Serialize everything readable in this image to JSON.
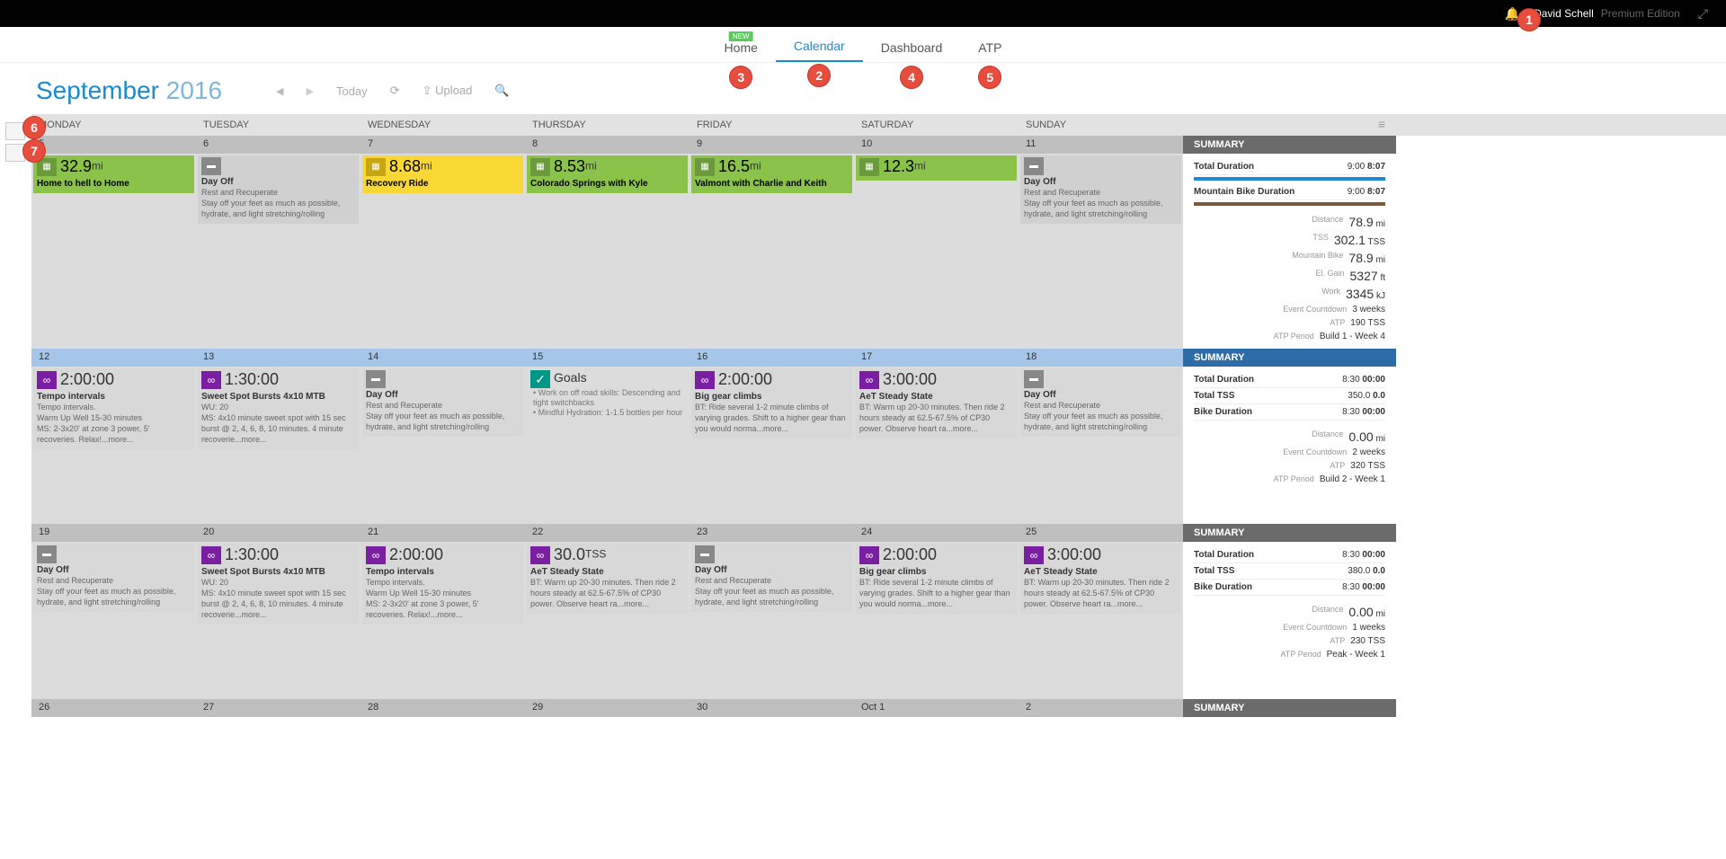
{
  "page": {
    "user": "David Schell",
    "edition": "Premium Edition"
  },
  "nav": {
    "home": "Home",
    "calendar": "Calendar",
    "dashboard": "Dashboard",
    "atp": "ATP",
    "new_badge": "NEW"
  },
  "circles": {
    "c1": "1",
    "c2": "2",
    "c3": "3",
    "c4": "4",
    "c5": "5",
    "c6": "6",
    "c7": "7"
  },
  "toolbar": {
    "month": "September",
    "year": "2016",
    "today": "Today",
    "upload": "Upload"
  },
  "dayHeaders": [
    "MONDAY",
    "TUESDAY",
    "WEDNESDAY",
    "THURSDAY",
    "FRIDAY",
    "SATURDAY",
    "SUNDAY"
  ],
  "summary_label": "SUMMARY",
  "week1": {
    "nums": [
      "5",
      "6",
      "7",
      "8",
      "9",
      "10",
      "11"
    ],
    "mon": {
      "value": "32.9",
      "unit": "mi",
      "title": "Home to hell to Home"
    },
    "tue": {
      "title": "Day Off",
      "sub": "Rest and Recuperate",
      "desc": "Stay off your feet as much as possible, hydrate, and light stretching/rolling"
    },
    "wed": {
      "value": "8.68",
      "unit": "mi",
      "title": "Recovery Ride"
    },
    "thu": {
      "value": "8.53",
      "unit": "mi",
      "title": "Colorado Springs with Kyle"
    },
    "fri": {
      "value": "16.5",
      "unit": "mi",
      "title": "Valmont with Charlie and Keith"
    },
    "sat": {
      "value": "12.3",
      "unit": "mi"
    },
    "sun": {
      "title": "Day Off",
      "sub": "Rest and Recuperate",
      "desc": "Stay off your feet as much as possible, hydrate, and light stretching/rolling"
    },
    "summary": {
      "total_duration_label": "Total Duration",
      "total_duration_plan": "9:00",
      "total_duration_act": "8:07",
      "mtb_label": "Mountain Bike Duration",
      "mtb_plan": "9:00",
      "mtb_act": "8:07",
      "stats": [
        {
          "k": "Distance",
          "v": "78.9",
          "u": "mi"
        },
        {
          "k": "TSS",
          "v": "302.1",
          "u": "TSS"
        },
        {
          "k": "Mountain Bike",
          "v": "78.9",
          "u": "mi"
        },
        {
          "k": "El. Gain",
          "v": "5327",
          "u": "ft"
        },
        {
          "k": "Work",
          "v": "3345",
          "u": "kJ"
        },
        {
          "k": "Event Countdown",
          "v": "3 weeks",
          "u": ""
        },
        {
          "k": "ATP",
          "v": "190 TSS",
          "u": ""
        },
        {
          "k": "ATP Period",
          "v": "Build 1 - Week 4",
          "u": ""
        }
      ]
    }
  },
  "week2": {
    "nums": [
      "12",
      "13",
      "14",
      "15",
      "16",
      "17",
      "18"
    ],
    "mon": {
      "value": "2:00:00",
      "title": "Tempo intervals",
      "desc": "Tempo intervals.\nWarm Up Well 15-30 minutes\nMS: 2-3x20' at zone 3 power, 5' recoveries. Relax!...more..."
    },
    "tue": {
      "value": "1:30:00",
      "title": "Sweet Spot Bursts 4x10 MTB",
      "desc": "WU: 20\nMS: 4x10 minute sweet spot with 15 sec burst @ 2, 4, 6, 8, 10 minutes. 4 minute recoverie...more..."
    },
    "wed": {
      "title": "Day Off",
      "sub": "Rest and Recuperate",
      "desc": "Stay off your feet as much as possible, hydrate, and light stretching/rolling"
    },
    "thu": {
      "title": "Goals",
      "g1": "Work on off road skills: Descending and tight switchbacks",
      "g2": "Mindful Hydration: 1-1.5 bottles per hour"
    },
    "fri": {
      "value": "2:00:00",
      "title": "Big gear climbs",
      "desc": "BT: Ride several 1-2 minute climbs of varying grades. Shift to a higher gear than you would norma...more..."
    },
    "sat": {
      "value": "3:00:00",
      "title": "AeT Steady State",
      "desc": "BT: Warm up 20-30 minutes. Then ride 2 hours steady at 62.5-67.5% of CP30 power. Observe heart ra...more..."
    },
    "sun": {
      "title": "Day Off",
      "sub": "Rest and Recuperate",
      "desc": "Stay off your feet as much as possible, hydrate, and light stretching/rolling"
    },
    "summary": {
      "total_duration_label": "Total Duration",
      "total_duration_plan": "8:30",
      "total_duration_act": "00:00",
      "tss_label": "Total TSS",
      "tss_plan": "350.0",
      "tss_act": "0.0",
      "bike_label": "Bike Duration",
      "bike_plan": "8:30",
      "bike_act": "00:00",
      "stats": [
        {
          "k": "Distance",
          "v": "0.00",
          "u": "mi"
        },
        {
          "k": "Event Countdown",
          "v": "2 weeks",
          "u": ""
        },
        {
          "k": "ATP",
          "v": "320 TSS",
          "u": ""
        },
        {
          "k": "ATP Period",
          "v": "Build 2 - Week 1",
          "u": ""
        }
      ]
    }
  },
  "week3": {
    "nums": [
      "19",
      "20",
      "21",
      "22",
      "23",
      "24",
      "25"
    ],
    "mon": {
      "title": "Day Off",
      "sub": "Rest and Recuperate",
      "desc": "Stay off your feet as much as possible, hydrate, and light stretching/rolling"
    },
    "tue": {
      "value": "1:30:00",
      "title": "Sweet Spot Bursts 4x10 MTB",
      "desc": "WU: 20\nMS: 4x10 minute sweet spot with 15 sec burst @ 2, 4, 6, 8, 10 minutes. 4 minute recoverie...more..."
    },
    "wed": {
      "value": "2:00:00",
      "title": "Tempo intervals",
      "desc": "Tempo intervals.\nWarm Up Well 15-30 minutes\nMS: 2-3x20' at zone 3 power, 5' recoveries. Relax!...more..."
    },
    "thu": {
      "value": "30.0",
      "unit": "TSS",
      "title": "AeT Steady State",
      "desc": "BT: Warm up 20-30 minutes. Then ride 2 hours steady at 62.5-67.5% of CP30 power. Observe heart ra...more..."
    },
    "fri": {
      "title": "Day Off",
      "sub": "Rest and Recuperate",
      "desc": "Stay off your feet as much as possible, hydrate, and light stretching/rolling"
    },
    "sat": {
      "value": "2:00:00",
      "title": "Big gear climbs",
      "desc": "BT: Ride several 1-2 minute climbs of varying grades. Shift to a higher gear than you would norma...more..."
    },
    "sun": {
      "value": "3:00:00",
      "title": "AeT Steady State",
      "desc": "BT: Warm up 20-30 minutes. Then ride 2 hours steady at 62.5-67.5% of CP30 power. Observe heart ra...more..."
    },
    "summary": {
      "total_duration_label": "Total Duration",
      "total_duration_plan": "8:30",
      "total_duration_act": "00:00",
      "tss_label": "Total TSS",
      "tss_plan": "380.0",
      "tss_act": "0.0",
      "bike_label": "Bike Duration",
      "bike_plan": "8:30",
      "bike_act": "00:00",
      "stats": [
        {
          "k": "Distance",
          "v": "0.00",
          "u": "mi"
        },
        {
          "k": "Event Countdown",
          "v": "1 weeks",
          "u": ""
        },
        {
          "k": "ATP",
          "v": "230 TSS",
          "u": ""
        },
        {
          "k": "ATP Period",
          "v": "Peak - Week 1",
          "u": ""
        }
      ]
    }
  },
  "week4": {
    "nums": [
      "26",
      "27",
      "28",
      "29",
      "30",
      "Oct 1",
      "2"
    ]
  }
}
